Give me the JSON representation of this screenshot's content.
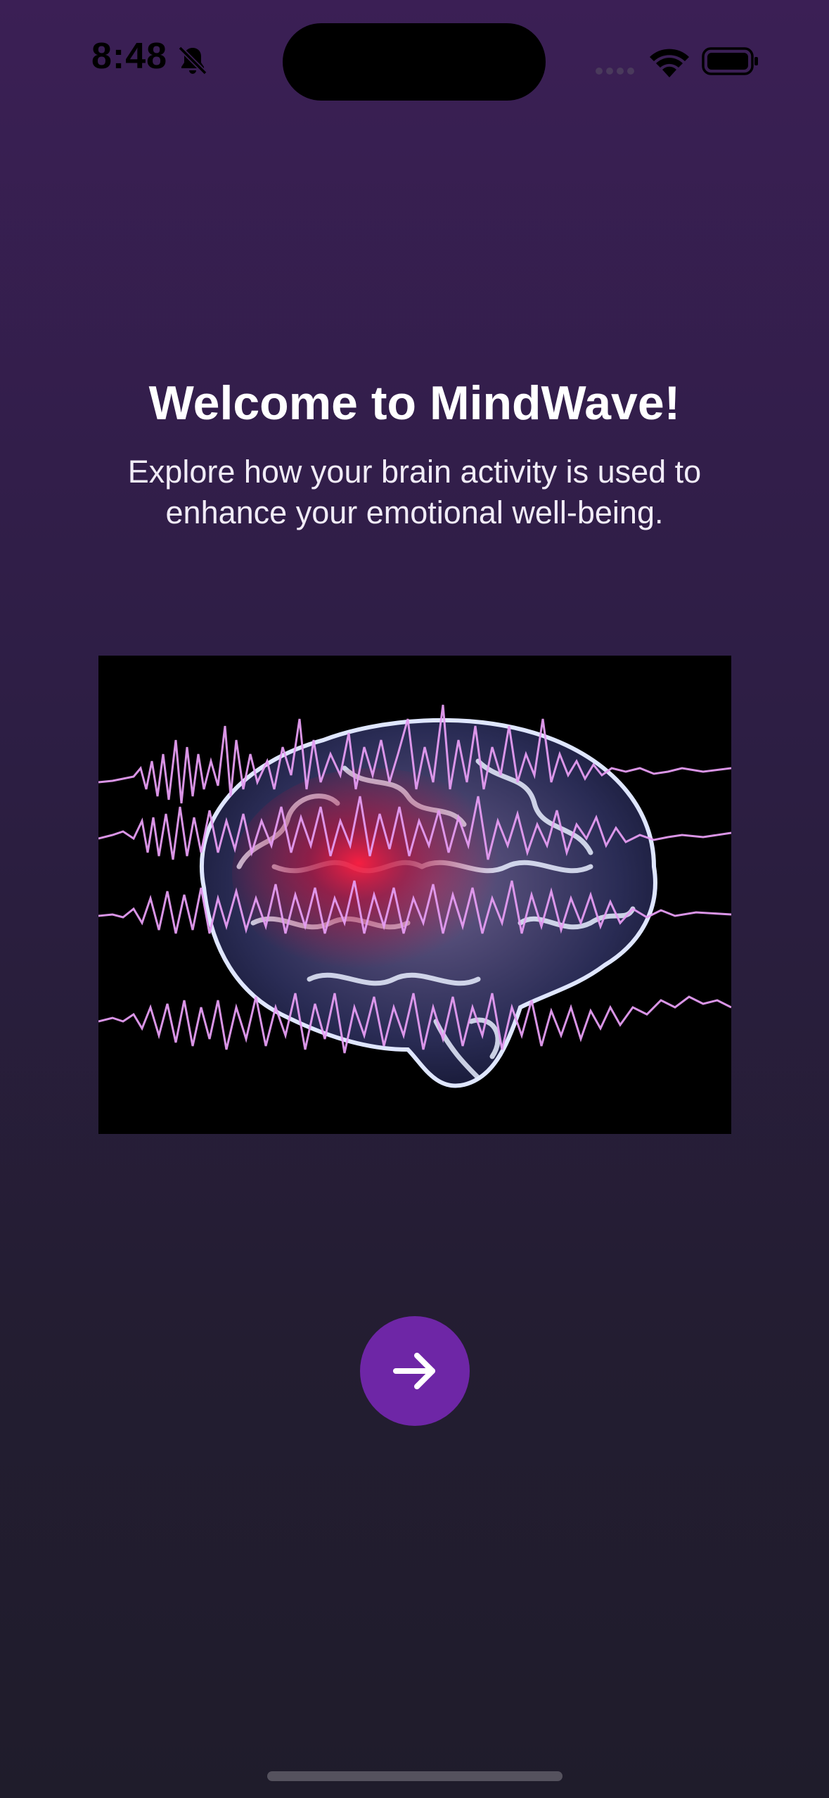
{
  "status_bar": {
    "time": "8:48",
    "icons": [
      "bell-slash-icon",
      "signal-icon",
      "wifi-icon",
      "battery-icon"
    ]
  },
  "onboarding": {
    "title": "Welcome to MindWave!",
    "subtitle": "Explore how your brain activity is used to enhance your emotional well-being.",
    "hero_image": "brain-with-eeg-waves-image",
    "next_button_icon": "arrow-right-icon"
  },
  "colors": {
    "background_top": "#3b1f55",
    "background_bottom": "#1f1c2b",
    "accent_button": "#6e26a6",
    "text": "#ffffff",
    "wave": "#e59cf2",
    "brain_glow": "#e0183c"
  }
}
